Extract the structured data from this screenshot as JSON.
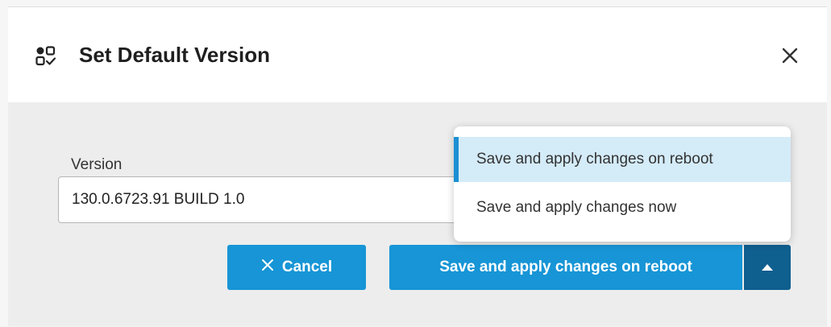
{
  "dialog": {
    "title": "Set Default Version",
    "title_icon": "version-grid-check-icon",
    "close_icon": "close-icon"
  },
  "form": {
    "version_label": "Version",
    "version_value": "130.0.6723.91 BUILD 1.0"
  },
  "actions": {
    "cancel_label": "Cancel",
    "cancel_icon": "close-icon",
    "save_label": "Save and apply changes on reboot",
    "toggle_icon": "caret-up-icon"
  },
  "menu": {
    "items": [
      {
        "label": "Save and apply changes on reboot",
        "selected": true
      },
      {
        "label": "Save and apply changes now",
        "selected": false
      }
    ]
  },
  "colors": {
    "primary": "#1795d6",
    "primary_dark": "#0f5f8f",
    "selected_bg": "#d4ebf8",
    "selected_bar": "#1b8fd3"
  }
}
